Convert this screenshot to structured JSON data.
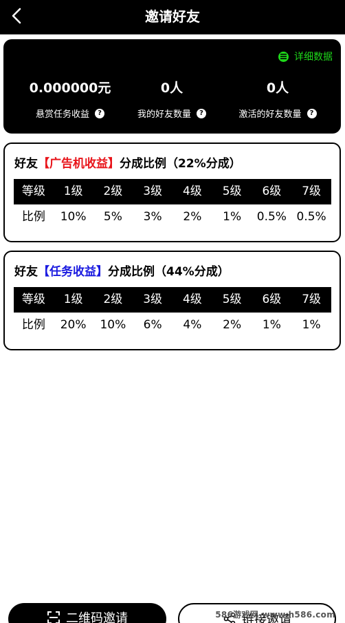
{
  "header": {
    "title": "邀请好友",
    "back_icon": "chevron-left-icon"
  },
  "stats": {
    "detail_label": "详细数据",
    "detail_icon": "list-icon",
    "accent_color": "#1ed81a",
    "items": [
      {
        "value": "0.000000元",
        "label": "悬赏任务收益"
      },
      {
        "value": "0人",
        "label": "我的好友数量"
      },
      {
        "value": "0人",
        "label": "激活的好友数量"
      }
    ],
    "help_glyph": "?"
  },
  "ad_ratio": {
    "title_prefix": "好友",
    "title_highlight": "【广告机收益】",
    "title_suffix": "分成比例（22%分成）",
    "highlight_color": "#e8141a",
    "headers": [
      "等级",
      "1级",
      "2级",
      "3级",
      "4级",
      "5级",
      "6级",
      "7级"
    ],
    "values": [
      "比例",
      "10%",
      "5%",
      "3%",
      "2%",
      "1%",
      "0.5%",
      "0.5%"
    ]
  },
  "task_ratio": {
    "title_prefix": "好友",
    "title_highlight": "【任务收益】",
    "title_suffix": "分成比例（44%分成）",
    "highlight_color": "#1a1ae0",
    "headers": [
      "等级",
      "1级",
      "2级",
      "3级",
      "4级",
      "5级",
      "6级",
      "7级"
    ],
    "values": [
      "比例",
      "20%",
      "10%",
      "6%",
      "4%",
      "2%",
      "1%",
      "1%"
    ]
  },
  "bottom": {
    "qr_label": "二维码邀请",
    "qr_icon": "qr-scan-icon",
    "link_label": "链接邀请",
    "link_icon": "share-icon"
  },
  "watermark": "586游戏网-www.h586.com"
}
